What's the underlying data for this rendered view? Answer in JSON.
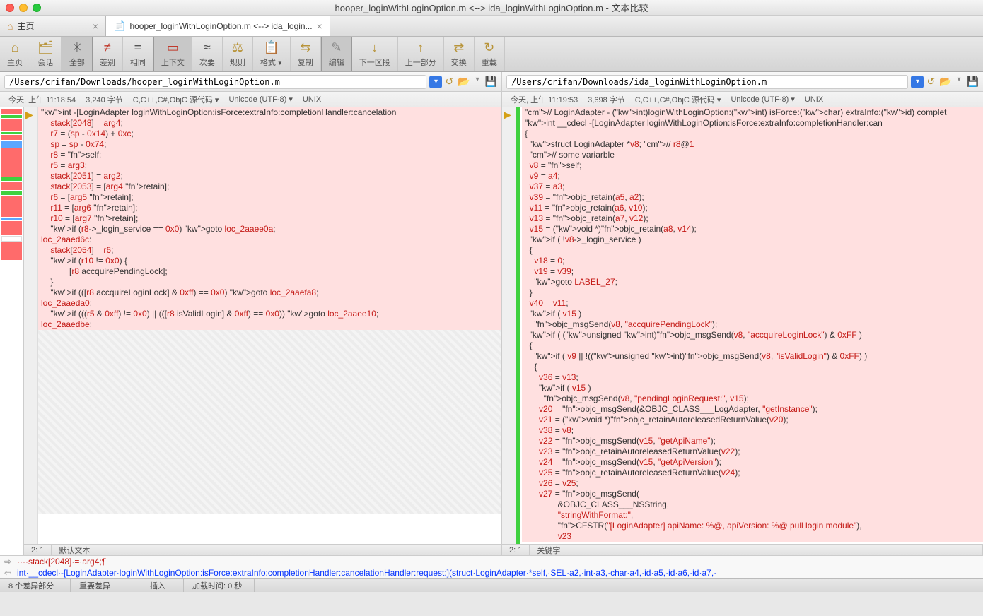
{
  "window": {
    "title": "hooper_loginWithLoginOption.m <--> ida_loginWithLoginOption.m - 文本比较"
  },
  "tabs": {
    "home": "主页",
    "diff": "hooper_loginWithLoginOption.m <--> ida_login..."
  },
  "toolbar": {
    "home": "主页",
    "session": "会话",
    "all": "全部",
    "diff": "差别",
    "same": "相同",
    "context": "上下文",
    "minor": "次要",
    "rules": "规则",
    "format": "格式",
    "copy": "复制",
    "edit": "编辑",
    "nextsec": "下一区段",
    "prevpart": "上一部分",
    "swap": "交换",
    "reload": "重载"
  },
  "paths": {
    "left": "/Users/crifan/Downloads/hooper_loginWithLoginOption.m",
    "right": "/Users/crifan/Downloads/ida_loginWithLoginOption.m"
  },
  "info": {
    "left_time": "今天, 上午 11:18:54",
    "left_size": "3,240 字节",
    "left_lang": "C,C++,C#,ObjC 源代码",
    "left_enc": "Unicode (UTF-8)",
    "left_eol": "UNIX",
    "right_time": "今天, 上午 11:19:53",
    "right_size": "3,698 字节",
    "right_lang": "C,C++,C#,ObjC 源代码",
    "right_enc": "Unicode (UTF-8)",
    "right_eol": "UNIX"
  },
  "code_left": [
    "int -[LoginAdapter loginWithLoginOption:isForce:extraInfo:completionHandler:cancelation",
    "    stack[2048] = arg4;",
    "    r7 = (sp - 0x14) + 0xc;",
    "    sp = sp - 0x74;",
    "    r8 = self;",
    "    r5 = arg3;",
    "    stack[2051] = arg2;",
    "    stack[2053] = [arg4 retain];",
    "    r6 = [arg5 retain];",
    "    r11 = [arg6 retain];",
    "    r10 = [arg7 retain];",
    "    if (r8->_login_service == 0x0) goto loc_2aaee0a;",
    "",
    "loc_2aaed6c:",
    "    stack[2054] = r6;",
    "    if (r10 != 0x0) {",
    "            [r8 accquirePendingLock];",
    "    }",
    "    if (([r8 accquireLoginLock] & 0xff) == 0x0) goto loc_2aaefa8;",
    "",
    "loc_2aaeda0:",
    "    if (((r5 & 0xff) != 0x0) || (([r8 isValidLogin] & 0xff) == 0x0)) goto loc_2aaee10;",
    "",
    "loc_2aaedbe:"
  ],
  "code_right": [
    "// LoginAdapter - (int)loginWithLoginOption:(int) isForce:(char) extraInfo:(id) complet",
    "int __cdecl -[LoginAdapter loginWithLoginOption:isForce:extraInfo:completionHandler:can",
    "{",
    "  struct LoginAdapter *v8; // r8@1",
    "  // some variarble",
    "",
    "  v8 = self;",
    "  v9 = a4;",
    "  v37 = a3;",
    "  v39 = objc_retain(a5, a2);",
    "  v11 = objc_retain(a6, v10);",
    "  v13 = objc_retain(a7, v12);",
    "  v15 = (void *)objc_retain(a8, v14);",
    "  if ( !v8->_login_service )",
    "  {",
    "    v18 = 0;",
    "    v19 = v39;",
    "    goto LABEL_27;",
    "  }",
    "  v40 = v11;",
    "  if ( v15 )",
    "    objc_msgSend(v8, \"accquirePendingLock\");",
    "  if ( (unsigned int)objc_msgSend(v8, \"accquireLoginLock\") & 0xFF )",
    "  {",
    "    if ( v9 || !((unsigned int)objc_msgSend(v8, \"isValidLogin\") & 0xFF) )",
    "    {",
    "      v36 = v13;",
    "      if ( v15 )",
    "        objc_msgSend(v8, \"pendingLoginRequest:\", v15);",
    "      v20 = objc_msgSend(&OBJC_CLASS___LogAdapter, \"getInstance\");",
    "      v21 = (void *)objc_retainAutoreleasedReturnValue(v20);",
    "      v38 = v8;",
    "      v22 = objc_msgSend(v15, \"getApiName\");",
    "      v23 = objc_retainAutoreleasedReturnValue(v22);",
    "      v24 = objc_msgSend(v15, \"getApiVersion\");",
    "      v25 = objc_retainAutoreleasedReturnValue(v24);",
    "      v26 = v25;",
    "      v27 = objc_msgSend(",
    "              &OBJC_CLASS___NSString,",
    "              \"stringWithFormat:\",",
    "              CFSTR(\"[LoginAdapter] apiName: %@, apiVersion: %@ pull login module\"),",
    "              v23"
  ],
  "status": {
    "left_pos": "2: 1",
    "left_mode": "默认文本",
    "right_pos": "2: 1",
    "right_mode": "关键字"
  },
  "srcrows": {
    "top": "····stack[2048]·=·arg4;¶",
    "bottom": "int·__cdecl·-[LoginAdapter·loginWithLoginOption:isForce:extraInfo:completionHandler:cancelationHandler:request:](struct·LoginAdapter·*self,·SEL·a2,·int·a3,·char·a4,·id·a5,·id·a6,·id·a7,·"
  },
  "footer": {
    "diffs": "8 个差异部分",
    "major": "重要差异",
    "insert": "插入",
    "load": "加载时间:  0 秒"
  }
}
